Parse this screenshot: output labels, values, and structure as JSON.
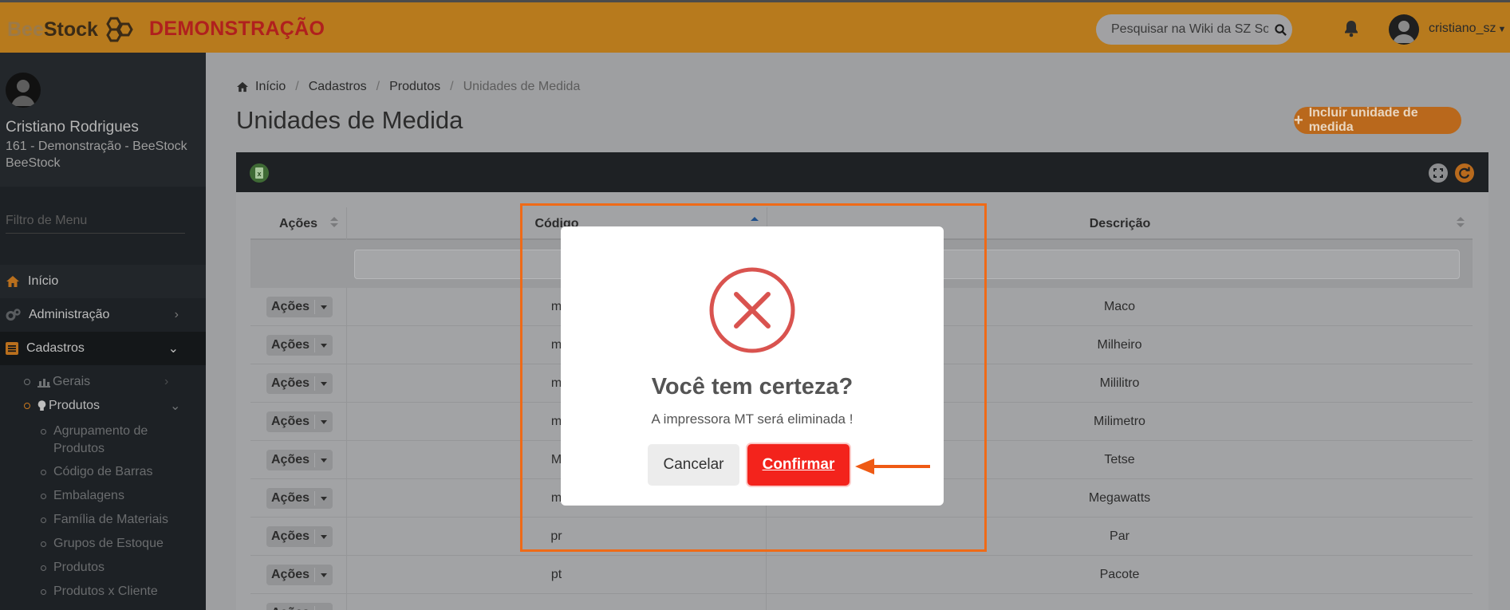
{
  "header": {
    "logo_bee": "Bee",
    "logo_stock": "Stock",
    "environment": "DEMONSTRAÇÃO",
    "search_placeholder": "Pesquisar na Wiki da SZ Soluções",
    "username": "cristiano_sz"
  },
  "sidebar": {
    "user_name": "Cristiano Rodrigues",
    "company": "161 - Demonstração - BeeStock BeeStock",
    "menu_filter_placeholder": "Filtro de Menu",
    "items": [
      {
        "label": "Início",
        "icon": "home-icon"
      },
      {
        "label": "Administração",
        "icon": "cogs-icon"
      },
      {
        "label": "Cadastros",
        "icon": "list-icon"
      }
    ],
    "cadastros_sub": [
      {
        "label": "Gerais",
        "icon": "chart-icon"
      },
      {
        "label": "Produtos",
        "icon": "lightbulb-icon"
      }
    ],
    "produtos_sub": [
      "Agrupamento de Produtos",
      "Código de Barras",
      "Embalagens",
      "Família de Materiais",
      "Grupos de Estoque",
      "Produtos",
      "Produtos x Cliente"
    ]
  },
  "breadcrumb": [
    "Início",
    "Cadastros",
    "Produtos",
    "Unidades de Medida"
  ],
  "page_title": "Unidades de Medida",
  "add_button": "Incluir unidade de medida",
  "table": {
    "columns": [
      "Ações",
      "Código",
      "Descrição"
    ],
    "action_label": "Ações",
    "rows": [
      {
        "codigo": "m",
        "descricao": "Maco"
      },
      {
        "codigo": "m",
        "descricao": "Milheiro"
      },
      {
        "codigo": "m",
        "descricao": "Mililitro"
      },
      {
        "codigo": "m",
        "descricao": "Milimetro"
      },
      {
        "codigo": "M",
        "descricao": "Tetse"
      },
      {
        "codigo": "m",
        "descricao": "Megawatts"
      },
      {
        "codigo": "pr",
        "descricao": "Par"
      },
      {
        "codigo": "pt",
        "descricao": "Pacote"
      },
      {
        "codigo": "",
        "descricao": ""
      }
    ]
  },
  "modal": {
    "title": "Você tem certeza?",
    "text": "A impressora MT será eliminada !",
    "cancel": "Cancelar",
    "confirm": "Confirmar"
  },
  "colors": {
    "header": "#b77a1d",
    "confirm": "#f3231c",
    "annotation": "#ef6a17",
    "error_icon": "#d9534f"
  }
}
